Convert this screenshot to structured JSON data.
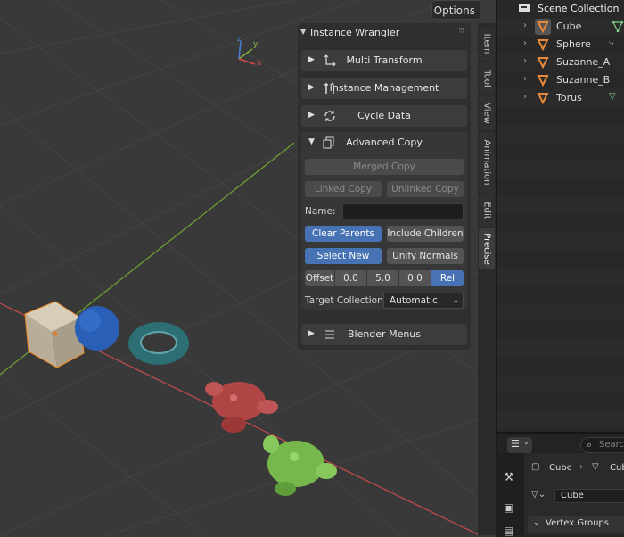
{
  "viewport": {
    "options_label": "Options",
    "gizmo": {
      "x": "x",
      "y": "y",
      "z": "z"
    }
  },
  "panel": {
    "title": "Instance Wrangler",
    "sections": [
      {
        "label": "Multi Transform",
        "icon": "transform-icon"
      },
      {
        "label": "Instance Management",
        "icon": "tools-icon"
      },
      {
        "label": "Cycle Data",
        "icon": "cycle-icon"
      }
    ],
    "advanced": {
      "label": "Advanced Copy",
      "merged_copy": "Merged Copy",
      "linked_copy": "Linked Copy",
      "unlinked_copy": "Unlinked Copy",
      "name_label": "Name:",
      "name_value": "",
      "clear_parents": "Clear Parents",
      "include_children": "Include Children",
      "select_new": "Select New",
      "unify_normals": "Unify Normals",
      "offset": {
        "label": "Offset",
        "x": "0.0",
        "y": "5.0",
        "z": "0.0",
        "mode": "Rel"
      },
      "target_label": "Target Collection:",
      "target_value": "Automatic"
    },
    "blender_menus": "Blender Menus"
  },
  "tabs": [
    "Item",
    "Tool",
    "View",
    "Animation",
    "Edit",
    "Precise"
  ],
  "active_tab": "Precise",
  "outliner": {
    "header": "Scene Collection",
    "items": [
      {
        "label": "Cube",
        "selected": true
      },
      {
        "label": "Sphere"
      },
      {
        "label": "Suzanne_A"
      },
      {
        "label": "Suzanne_B"
      },
      {
        "label": "Torus"
      }
    ]
  },
  "properties": {
    "search_placeholder": "Searc",
    "breadcrumb_object": "Cube",
    "breadcrumb_mesh": "Cub",
    "mesh_name": "Cube",
    "vertex_groups": "Vertex Groups"
  },
  "colors": {
    "accent": "#4772b3",
    "object_orange": "#e8893a",
    "axis_x": "#d94a4a",
    "axis_y": "#7fb23a"
  }
}
